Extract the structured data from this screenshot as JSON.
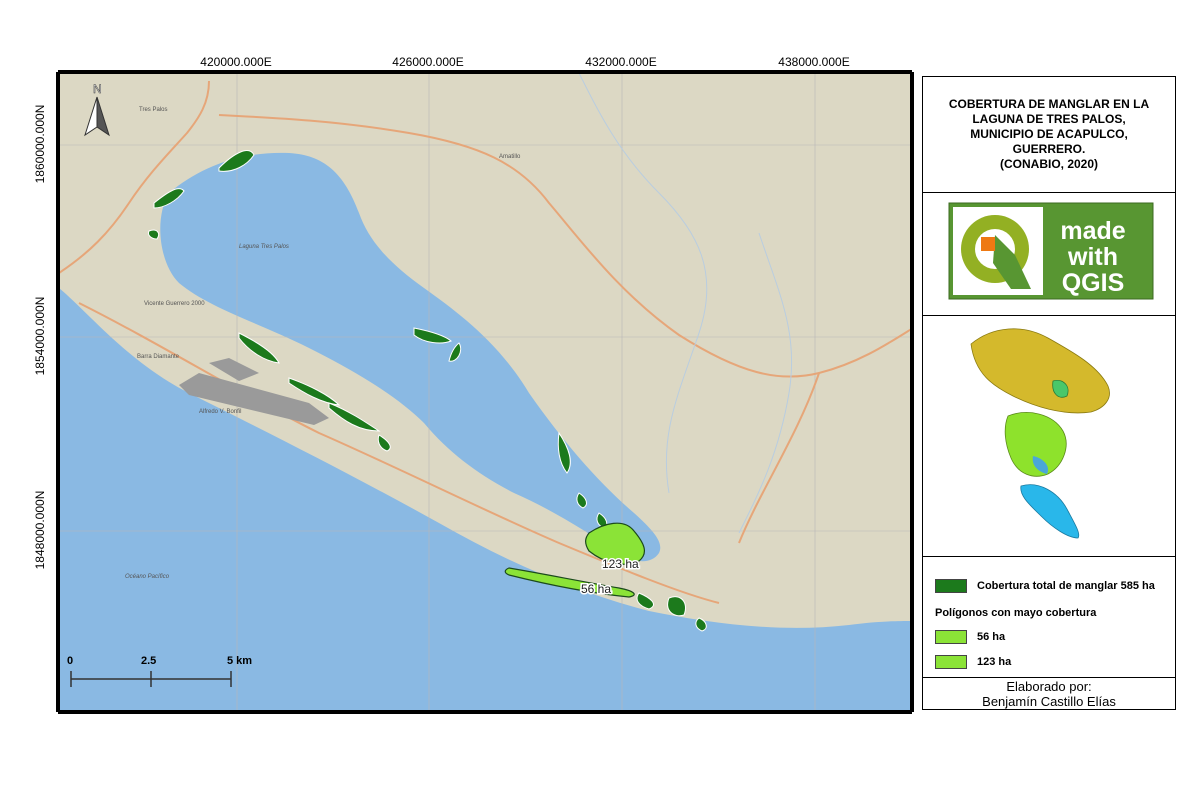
{
  "map": {
    "coords_top": [
      "420000.000E",
      "426000.000E",
      "432000.000E",
      "438000.000E"
    ],
    "coords_left": [
      "1860000.000N",
      "1854000.000N",
      "1848000.000N"
    ],
    "north_arrow_label": "N",
    "place_labels": {
      "tres_palos": "Tres Palos",
      "amatillo": "Amatillo",
      "laguna": "Laguna Tres Palos",
      "vicente_guerrero": "Vicente Guerrero 2000",
      "barra_diamante": "Barra Diamante",
      "alfredo_bonfil": "Alfredo V. Bonfil",
      "oceano": "Océano Pacífico"
    },
    "polygon_labels": {
      "p123": "123 ha",
      "p56": "56 ha"
    },
    "scale_bar": {
      "labels": [
        "0",
        "2.5",
        "5 km"
      ]
    },
    "colors": {
      "land": "#dcd8c4",
      "water": "#8ab9e3",
      "mangrove": "#1c7a1c",
      "highlight": "#8be337",
      "road": "#e6a679"
    }
  },
  "legend": {
    "title_lines": [
      "COBERTURA DE MANGLAR EN LA",
      "LAGUNA DE TRES PALOS,",
      "MUNICIPIO DE ACAPULCO,",
      "GUERRERO.",
      "(CONABIO, 2020)"
    ],
    "logo": {
      "line1": "made",
      "line2": "with",
      "line3": "QGIS",
      "icon": "qgis-logo-icon"
    },
    "items": {
      "total": "Cobertura total de manglar 585 ha",
      "subtitle": "Polígonos con mayo cobertura",
      "p56": "56 ha",
      "p123": "123 ha"
    },
    "author_label": "Elaborado por:",
    "author_name": "Benjamín Castillo Elías"
  }
}
